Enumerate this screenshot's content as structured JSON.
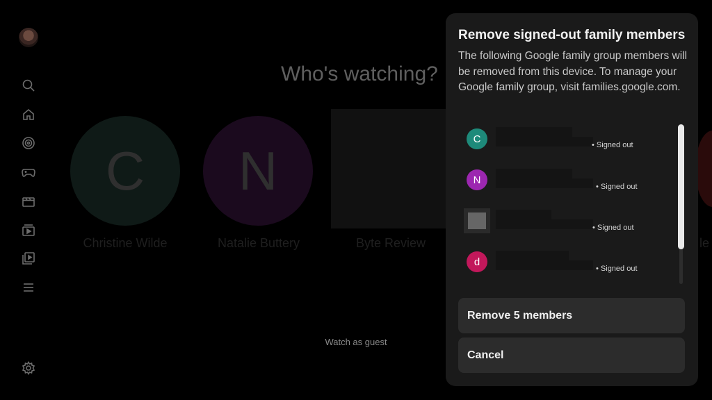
{
  "home": {
    "heading": "Who's watching?",
    "profiles": [
      {
        "initial": "C",
        "name": "Christine Wilde"
      },
      {
        "initial": "N",
        "name": "Natalie Buttery"
      },
      {
        "name": "Byte Review"
      }
    ],
    "edge_text": "le",
    "guest_label": "Watch as guest"
  },
  "dialog": {
    "title": "Remove signed-out family members",
    "description": "The following Google family group members will be removed from this device. To manage your Google family group, visit families.google.com.",
    "members": [
      {
        "initial": "C",
        "color": "#1e8a7a",
        "status": "• Signed out"
      },
      {
        "initial": "N",
        "color": "#9c27b0",
        "status": "• Signed out"
      },
      {
        "initial": "",
        "color": "#666666",
        "status": "• Signed out"
      },
      {
        "initial": "d",
        "color": "#c2185b",
        "status": "• Signed out"
      }
    ],
    "remove_label": "Remove 5 members",
    "cancel_label": "Cancel"
  },
  "icons": [
    "search-icon",
    "home-icon",
    "target-icon",
    "gamepad-icon",
    "clapperboard-icon",
    "subscriptions-icon",
    "library-icon",
    "menu-icon",
    "settings-icon"
  ]
}
